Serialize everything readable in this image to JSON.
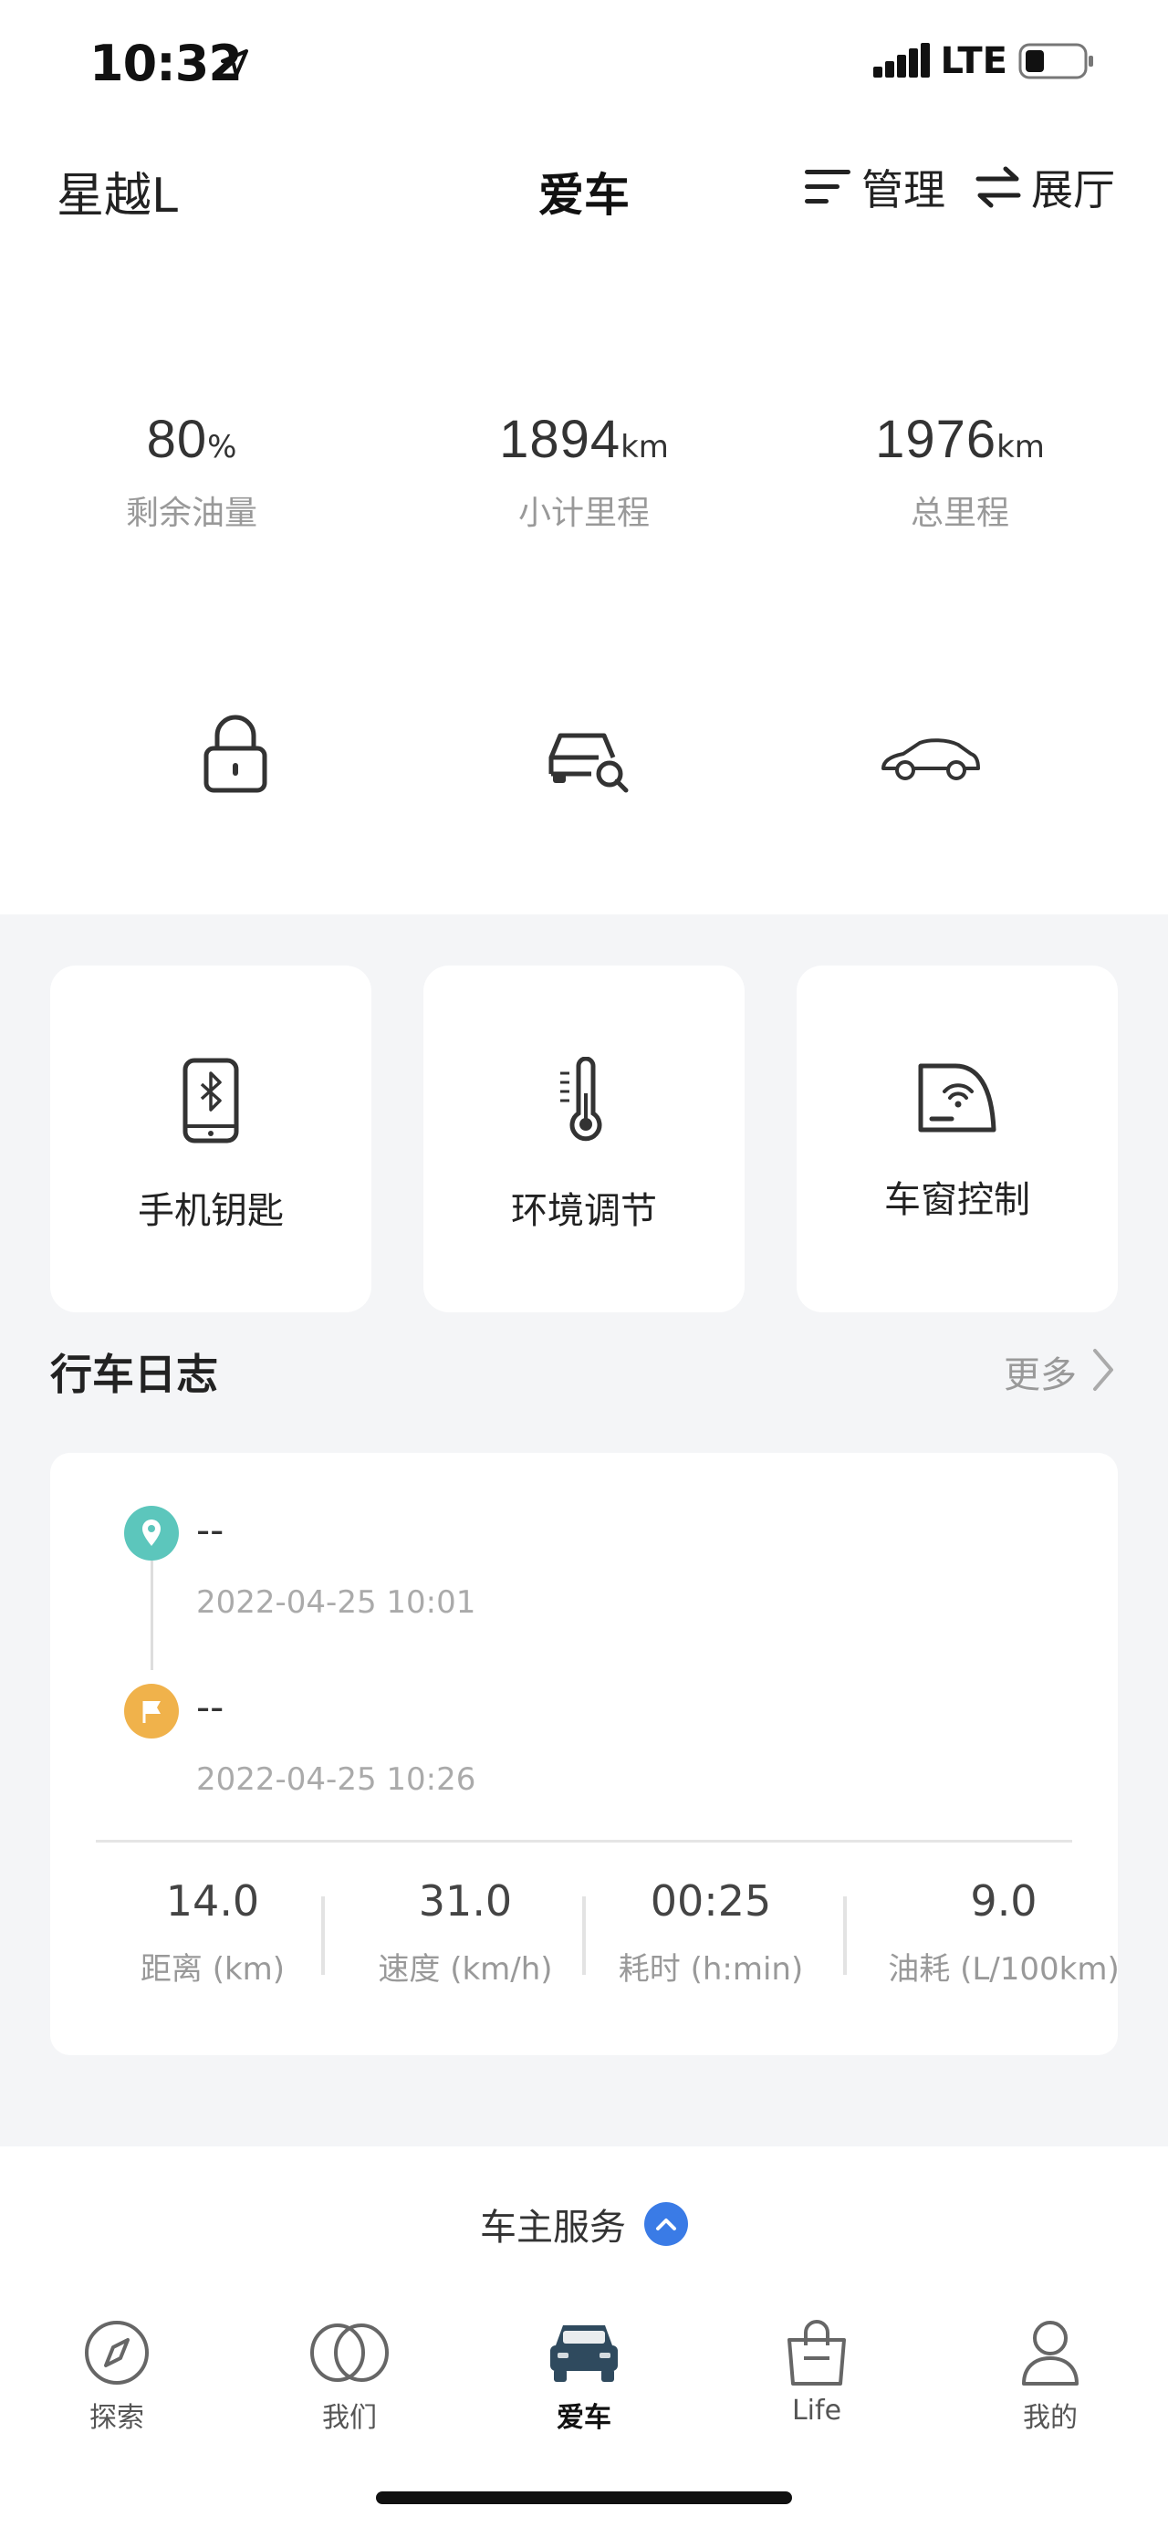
{
  "status_bar": {
    "time": "10:32",
    "network": "LTE",
    "icons": [
      "location-arrow-icon",
      "signal-icon",
      "battery-icon"
    ]
  },
  "header": {
    "vehicle_name": "星越L",
    "title": "爱车",
    "manage_label": "管理",
    "showroom_label": "展厅"
  },
  "stats": [
    {
      "value": "80",
      "unit": "%",
      "label": "剩余油量"
    },
    {
      "value": "1894",
      "unit": "km",
      "label": "小计里程"
    },
    {
      "value": "1976",
      "unit": "km",
      "label": "总里程"
    }
  ],
  "quick_actions": [
    "lock-icon",
    "car-search-icon",
    "car-side-icon"
  ],
  "cards": [
    {
      "label": "手机钥匙",
      "icon": "bluetooth-phone-icon"
    },
    {
      "label": "环境调节",
      "icon": "thermometer-icon"
    },
    {
      "label": "车窗控制",
      "icon": "car-window-icon"
    }
  ],
  "drive_log": {
    "title": "行车日志",
    "more_label": "更多",
    "start": {
      "place": "--",
      "time": "2022-04-25 10:01"
    },
    "end": {
      "place": "--",
      "time": "2022-04-25 10:26"
    },
    "metrics": [
      {
        "value": "14.0",
        "label": "距离 (km)"
      },
      {
        "value": "31.0",
        "label": "速度 (km/h)"
      },
      {
        "value": "00:25",
        "label": "耗时 (h:min)"
      },
      {
        "value": "9.0",
        "label": "油耗 (L/100km)"
      }
    ]
  },
  "service": {
    "label": "车主服务"
  },
  "tabs": [
    {
      "label": "探索",
      "icon": "compass-icon"
    },
    {
      "label": "我们",
      "icon": "rings-icon"
    },
    {
      "label": "爱车",
      "icon": "car-front-icon"
    },
    {
      "label": "Life",
      "icon": "shopping-bag-icon"
    },
    {
      "label": "我的",
      "icon": "person-icon"
    }
  ],
  "colors": {
    "accent_blue": "#3a7be6",
    "start_dot": "#5cc6bc",
    "end_dot": "#f0b24b",
    "active_tab": "#2f4a5e"
  }
}
